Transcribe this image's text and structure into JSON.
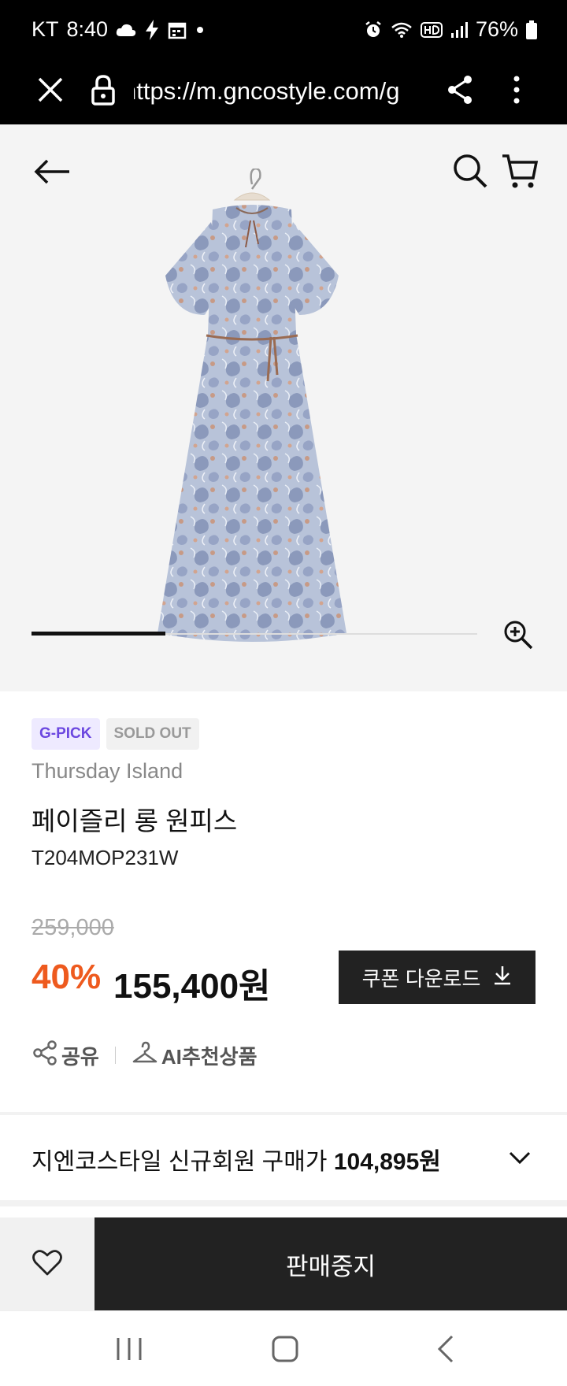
{
  "status_bar": {
    "carrier": "KT",
    "time": "8:40",
    "battery": "76%"
  },
  "browser": {
    "url": "https://m.gncostyle.com/g"
  },
  "product": {
    "badges": [
      "G-PICK",
      "SOLD OUT"
    ],
    "brand": "Thursday Island",
    "name": "페이즐리 롱 원피스",
    "code": "T204MOP231W",
    "original_price": "259,000",
    "discount": "40%",
    "sale_price": "155,400원",
    "image_slider_progress": 0.3
  },
  "buttons": {
    "coupon": "쿠폰 다운로드",
    "share": "공유",
    "ai_recommend": "AI추천상품",
    "buy": "판매중지"
  },
  "member_price": {
    "label": "지엔코스타일 신규회원 구매가",
    "value": "104,895원"
  },
  "colors": {
    "accent": "#ee5a1e",
    "gpick": "#6b47e0",
    "dark": "#222222"
  }
}
